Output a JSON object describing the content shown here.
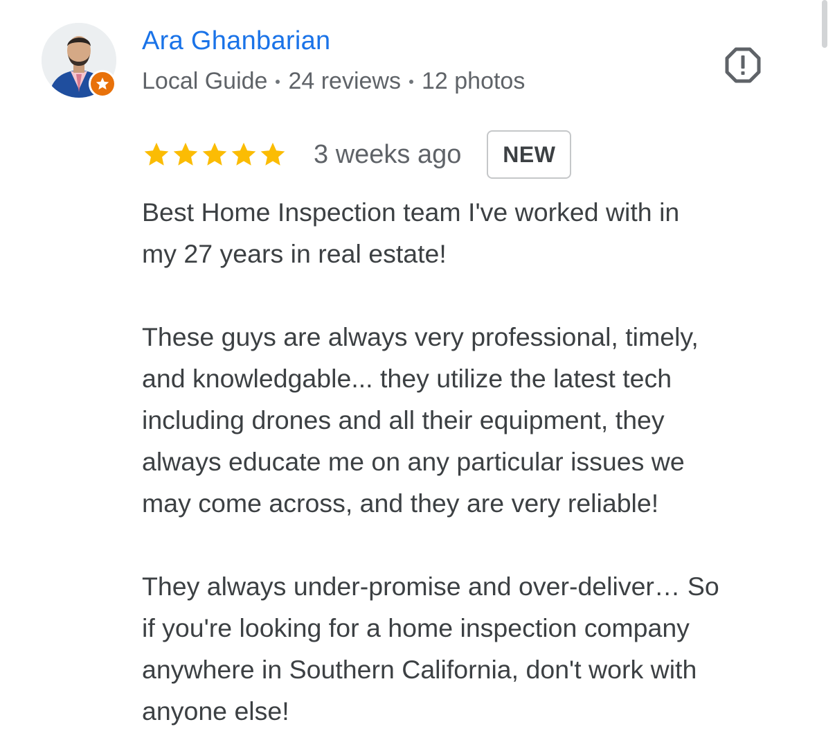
{
  "reviewer": {
    "name": "Ara Ghanbarian",
    "meta": [
      "Local Guide",
      "24 reviews",
      "12 photos"
    ],
    "avatar_icon": "person-avatar-photo",
    "badge_icon": "local-guide-star-icon",
    "badge_color": "#e8710a"
  },
  "review": {
    "rating": 5,
    "rating_max": 5,
    "star_color": "#fbbc04",
    "date": "3 weeks ago",
    "badge": "NEW",
    "paragraphs": [
      [
        "Best Home Inspection team I've worked with in",
        "my 27 years in real estate!"
      ],
      [
        "These guys are always very professional, timely,",
        "and knowledgable... they utilize the latest tech",
        "including drones and all their equipment, they",
        "always educate me on any particular issues we",
        "may come across, and they are very reliable!"
      ],
      [
        "They always under-promise and over-deliver… So",
        "if you're looking for a home inspection company",
        "anywhere in Southern California, don't work with",
        "anyone else!"
      ]
    ]
  },
  "actions": {
    "report_icon": "report-octagon-icon"
  },
  "colors": {
    "name": "#1a73e8",
    "text": "#3c4043",
    "meta": "#5f6368"
  }
}
